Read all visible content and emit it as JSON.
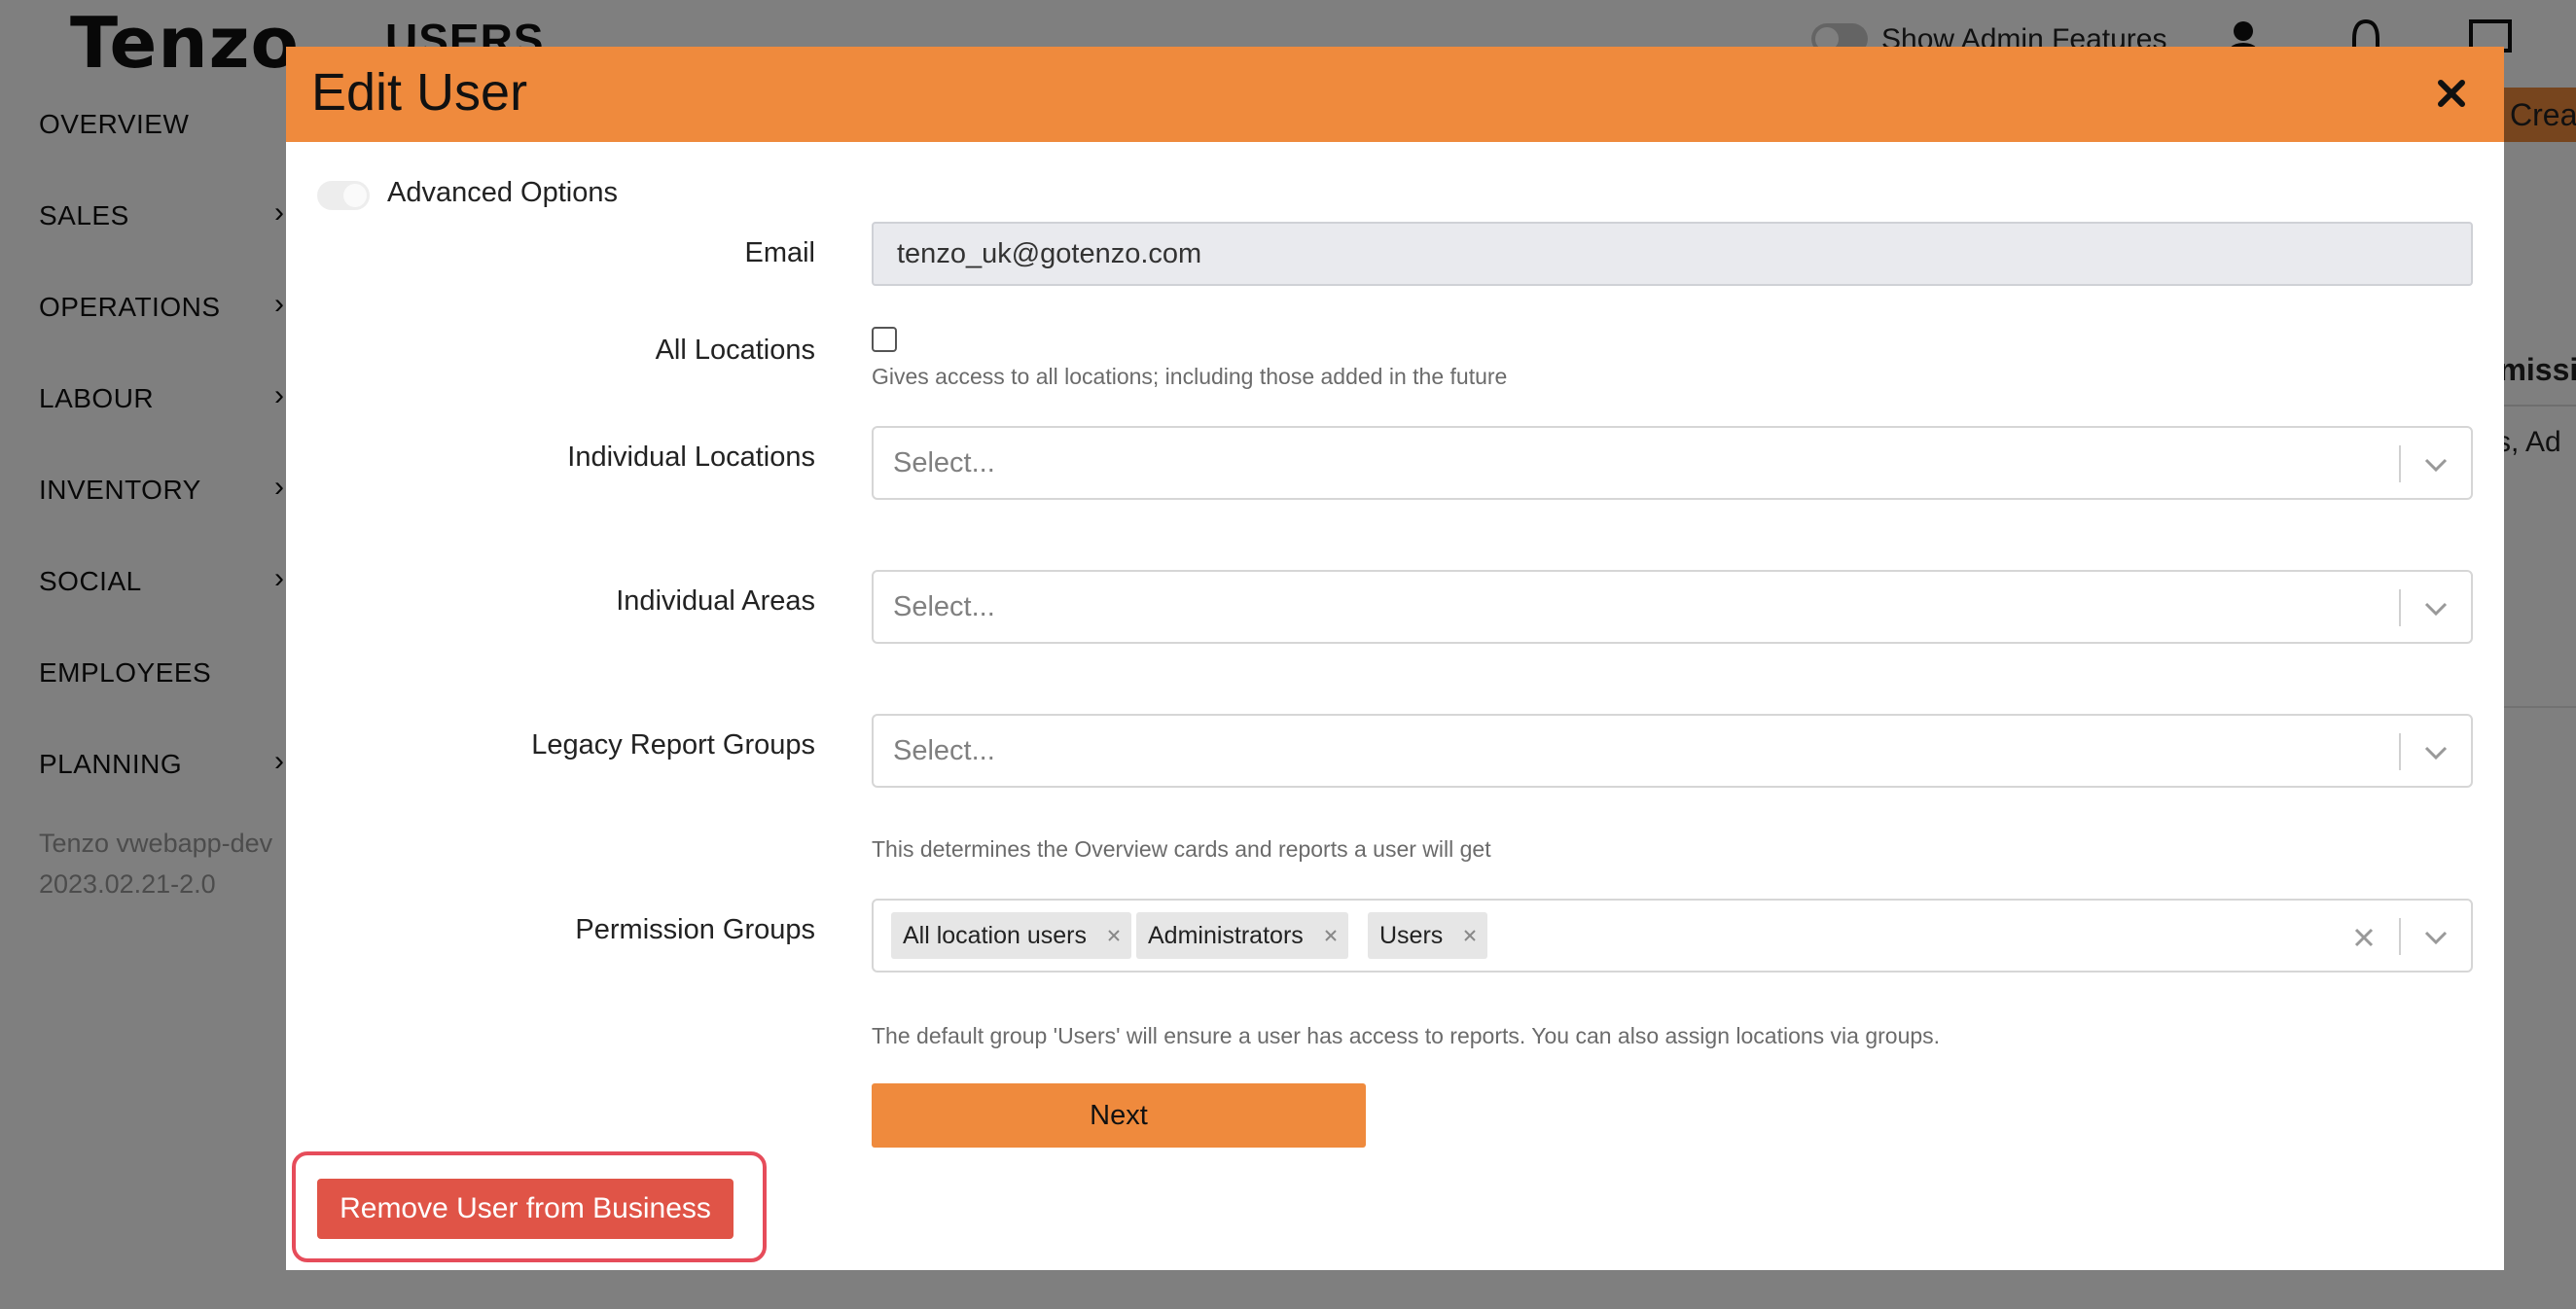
{
  "app": {
    "logo": "Tenzo",
    "page_title": "USERS",
    "admin_toggle_label": "Show Admin Features",
    "create_button_label": "Crea",
    "bg_column_header": "rmissi",
    "bg_cell_text": "rs, Ad"
  },
  "sidebar": {
    "items": [
      {
        "label": "OVERVIEW",
        "has_chevron": false
      },
      {
        "label": "SALES",
        "has_chevron": true
      },
      {
        "label": "OPERATIONS",
        "has_chevron": true
      },
      {
        "label": "LABOUR",
        "has_chevron": true
      },
      {
        "label": "INVENTORY",
        "has_chevron": true
      },
      {
        "label": "SOCIAL",
        "has_chevron": true
      },
      {
        "label": "EMPLOYEES",
        "has_chevron": false
      },
      {
        "label": "PLANNING",
        "has_chevron": true
      }
    ],
    "version_line1": "Tenzo vwebapp-dev",
    "version_line2": "2023.02.21-2.0"
  },
  "modal": {
    "title": "Edit User",
    "advanced_options_label": "Advanced Options",
    "email": {
      "label": "Email",
      "value": "tenzo_uk@gotenzo.com"
    },
    "all_locations": {
      "label": "All Locations",
      "help": "Gives access to all locations; including those added in the future",
      "checked": false
    },
    "individual_locations": {
      "label": "Individual Locations",
      "placeholder": "Select..."
    },
    "individual_areas": {
      "label": "Individual Areas",
      "placeholder": "Select..."
    },
    "legacy_report_groups": {
      "label": "Legacy Report Groups",
      "placeholder": "Select...",
      "help": "This determines the Overview cards and reports a user will get"
    },
    "permission_groups": {
      "label": "Permission Groups",
      "chips": [
        "All location users",
        "Administrators",
        "Users"
      ],
      "help": "The default group 'Users' will ensure a user has access to reports. You can also assign locations via groups."
    },
    "next_label": "Next",
    "remove_label": "Remove User from Business"
  },
  "colors": {
    "accent": "#ef8a3d",
    "danger": "#e05447",
    "highlight": "#e64c5a"
  }
}
